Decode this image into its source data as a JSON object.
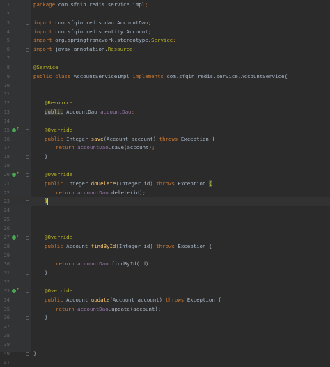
{
  "lines": [
    {
      "n": "1",
      "i": 0,
      "t": [
        [
          "kw",
          "package "
        ],
        [
          "ident",
          "com.sfqin.redis.service.impl"
        ],
        [
          "kw",
          ";"
        ]
      ]
    },
    {
      "n": "2",
      "i": 0,
      "t": []
    },
    {
      "n": "3",
      "i": 0,
      "fold": true,
      "t": [
        [
          "kw",
          "import "
        ],
        [
          "ident",
          "com.sfqin.redis.dao.AccountDao"
        ],
        [
          "kw",
          ";"
        ]
      ]
    },
    {
      "n": "4",
      "i": 0,
      "t": [
        [
          "kw",
          "import "
        ],
        [
          "ident",
          "com.sfqin.redis.entity.Account"
        ],
        [
          "kw",
          ";"
        ]
      ]
    },
    {
      "n": "5",
      "i": 0,
      "t": [
        [
          "kw",
          "import "
        ],
        [
          "ident",
          "org.springframework.stereotype."
        ],
        [
          "ann",
          "Service"
        ],
        [
          "kw",
          ";"
        ]
      ]
    },
    {
      "n": "6",
      "i": 0,
      "fold": true,
      "t": [
        [
          "kw",
          "import "
        ],
        [
          "ident",
          "javax.annotation."
        ],
        [
          "ann",
          "Resource"
        ],
        [
          "kw",
          ";"
        ]
      ]
    },
    {
      "n": "7",
      "i": 0,
      "t": []
    },
    {
      "n": "8",
      "i": 0,
      "t": [
        [
          "ann",
          "@Service"
        ]
      ]
    },
    {
      "n": "9",
      "i": 0,
      "t": [
        [
          "kw",
          "public class "
        ],
        [
          "warn",
          "AccountServiceImpl"
        ],
        [
          "ident",
          " "
        ],
        [
          "kw",
          "implements "
        ],
        [
          "ident",
          "com.sfqin.redis.service.AccountService{"
        ]
      ]
    },
    {
      "n": "10",
      "i": 0,
      "t": []
    },
    {
      "n": "11",
      "i": 0,
      "t": []
    },
    {
      "n": "12",
      "i": 1,
      "t": [
        [
          "ann",
          "@Resource"
        ]
      ]
    },
    {
      "n": "13",
      "i": 1,
      "t": [
        [
          "hl",
          "public"
        ],
        [
          "ident",
          " AccountDao "
        ],
        [
          "field",
          "accountDao"
        ],
        [
          "kw",
          ";"
        ]
      ]
    },
    {
      "n": "14",
      "i": 0,
      "t": []
    },
    {
      "n": "15",
      "i": 1,
      "fold": true,
      "marker": true,
      "t": [
        [
          "ann",
          "@Override"
        ]
      ]
    },
    {
      "n": "16",
      "i": 1,
      "t": [
        [
          "kw",
          "public "
        ],
        [
          "ident",
          "Integer "
        ],
        [
          "method",
          "save"
        ],
        [
          "ident",
          "(Account account) "
        ],
        [
          "kw",
          "throws "
        ],
        [
          "ident",
          "Exception {"
        ]
      ]
    },
    {
      "n": "17",
      "i": 2,
      "t": [
        [
          "kw",
          "return "
        ],
        [
          "field",
          "accountDao"
        ],
        [
          "ident",
          ".save(account)"
        ],
        [
          "kw",
          ";"
        ]
      ]
    },
    {
      "n": "18",
      "i": 1,
      "fold": true,
      "t": [
        [
          "ident",
          "}"
        ]
      ]
    },
    {
      "n": "19",
      "i": 0,
      "t": []
    },
    {
      "n": "20",
      "i": 1,
      "fold": true,
      "marker": true,
      "t": [
        [
          "ann",
          "@Override"
        ]
      ]
    },
    {
      "n": "21",
      "i": 1,
      "t": [
        [
          "kw",
          "public "
        ],
        [
          "ident",
          "Integer "
        ],
        [
          "method",
          "doDelete"
        ],
        [
          "ident",
          "(Integer id) "
        ],
        [
          "kw",
          "throws "
        ],
        [
          "ident",
          "Exception "
        ],
        [
          "brace-match",
          "{"
        ]
      ]
    },
    {
      "n": "22",
      "i": 2,
      "t": [
        [
          "kw",
          "return "
        ],
        [
          "field",
          "accountDao"
        ],
        [
          "ident",
          ".delete(id)"
        ],
        [
          "kw",
          ";"
        ]
      ]
    },
    {
      "n": "23",
      "i": 1,
      "fold": true,
      "current": true,
      "t": [
        [
          "brace-match",
          "}"
        ],
        [
          "caret",
          ""
        ]
      ]
    },
    {
      "n": "24",
      "i": 0,
      "t": []
    },
    {
      "n": "25",
      "i": 0,
      "t": []
    },
    {
      "n": "26",
      "i": 0,
      "t": []
    },
    {
      "n": "27",
      "i": 1,
      "fold": true,
      "marker": true,
      "t": [
        [
          "ann",
          "@Override"
        ]
      ]
    },
    {
      "n": "28",
      "i": 1,
      "t": [
        [
          "kw",
          "public "
        ],
        [
          "ident",
          "Account "
        ],
        [
          "method",
          "findById"
        ],
        [
          "ident",
          "(Integer id) "
        ],
        [
          "kw",
          "throws "
        ],
        [
          "ident",
          "Exception {"
        ]
      ]
    },
    {
      "n": "29",
      "i": 0,
      "t": []
    },
    {
      "n": "30",
      "i": 2,
      "t": [
        [
          "kw",
          "return "
        ],
        [
          "field",
          "accountDao"
        ],
        [
          "ident",
          ".findById(id)"
        ],
        [
          "kw",
          ";"
        ]
      ]
    },
    {
      "n": "31",
      "i": 1,
      "fold": true,
      "t": [
        [
          "ident",
          "}"
        ]
      ]
    },
    {
      "n": "32",
      "i": 0,
      "t": []
    },
    {
      "n": "33",
      "i": 1,
      "fold": true,
      "marker": true,
      "t": [
        [
          "ann",
          "@Override"
        ]
      ]
    },
    {
      "n": "34",
      "i": 1,
      "t": [
        [
          "kw",
          "public "
        ],
        [
          "ident",
          "Account "
        ],
        [
          "method",
          "update"
        ],
        [
          "ident",
          "(Account account) "
        ],
        [
          "kw",
          "throws "
        ],
        [
          "ident",
          "Exception {"
        ]
      ]
    },
    {
      "n": "35",
      "i": 2,
      "t": [
        [
          "kw",
          "return "
        ],
        [
          "field",
          "accountDao"
        ],
        [
          "ident",
          ".update(account)"
        ],
        [
          "kw",
          ";"
        ]
      ]
    },
    {
      "n": "36",
      "i": 1,
      "fold": true,
      "t": [
        [
          "ident",
          "}"
        ]
      ]
    },
    {
      "n": "37",
      "i": 0,
      "t": []
    },
    {
      "n": "38",
      "i": 0,
      "t": []
    },
    {
      "n": "39",
      "i": 0,
      "t": []
    },
    {
      "n": "40",
      "i": 0,
      "fold": true,
      "t": [
        [
          "ident",
          "}"
        ]
      ]
    },
    {
      "n": "41",
      "i": 0,
      "t": []
    }
  ],
  "icons": {
    "override_marker": "implements-method-icon",
    "fold": "fold-marker-icon"
  }
}
